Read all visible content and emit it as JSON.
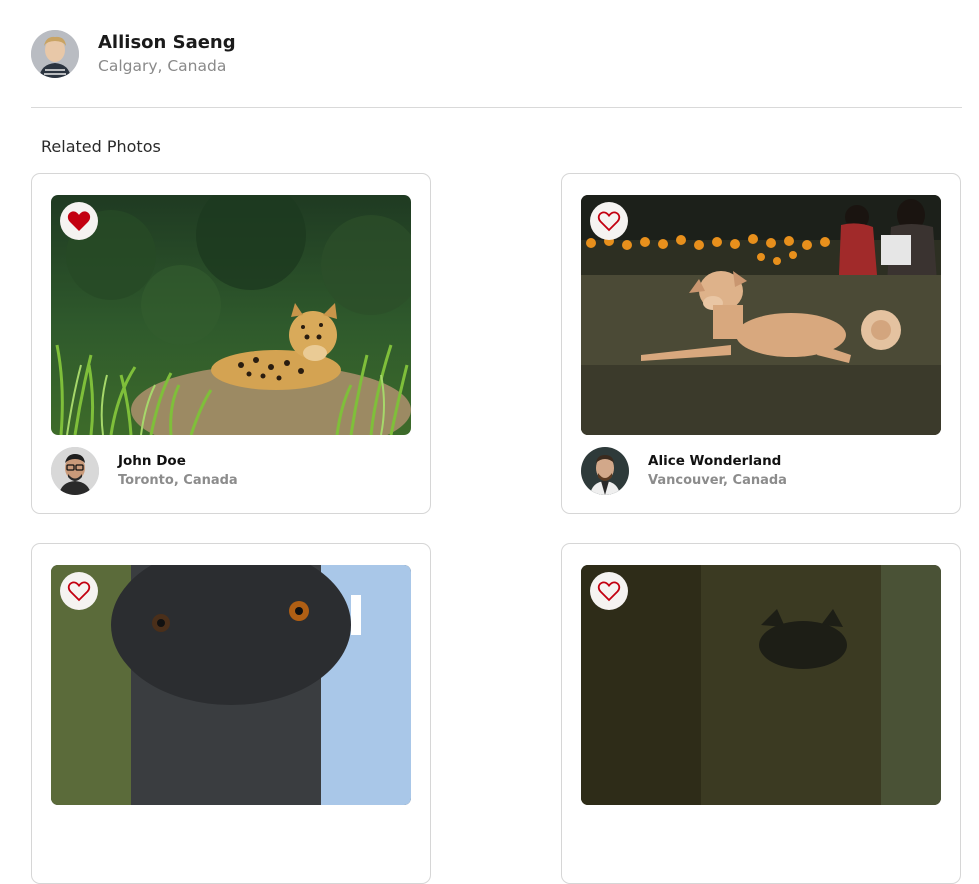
{
  "profile": {
    "name": "Allison Saeng",
    "location": "Calgary, Canada"
  },
  "section": {
    "title": "Related Photos"
  },
  "cards": [
    {
      "liked": true,
      "owner_name": "John Doe",
      "owner_location": "Toronto, Canada",
      "photo_subject": "jaguar"
    },
    {
      "liked": false,
      "owner_name": "Alice Wonderland",
      "owner_location": "Vancouver, Canada",
      "photo_subject": "dog"
    },
    {
      "liked": false,
      "photo_subject": "black-dog"
    },
    {
      "liked": false,
      "photo_subject": "cat"
    }
  ],
  "colors": {
    "heart": "#c30010",
    "divider": "#d9d9d9",
    "muted_text": "#8a8a8a"
  }
}
